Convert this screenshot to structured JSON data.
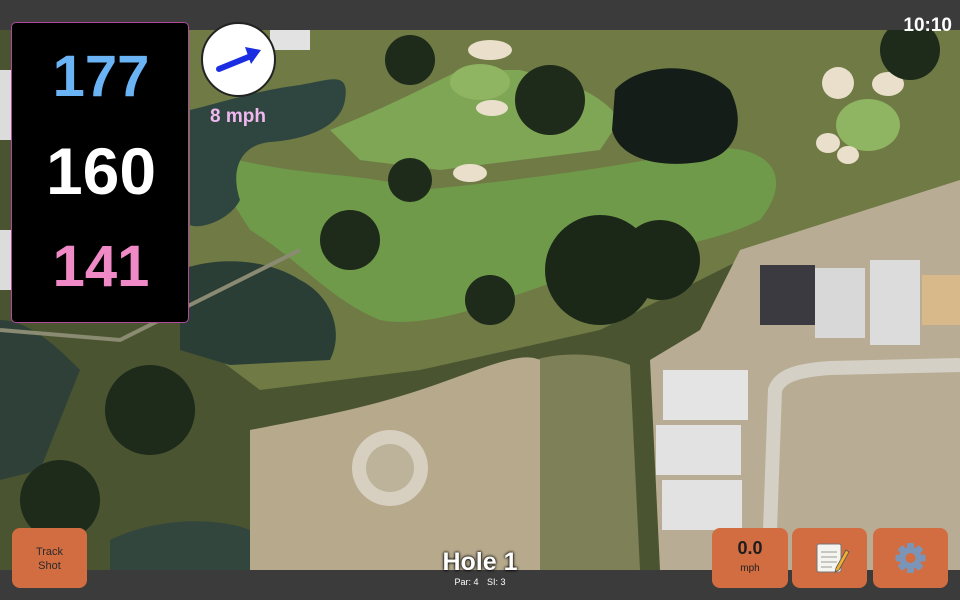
{
  "status": {
    "time": "10:10"
  },
  "distances": {
    "back": "177",
    "middle": "160",
    "front": "141",
    "back_color": "#6ab4f5",
    "middle_color": "#ffffff",
    "front_color": "#f08ac7"
  },
  "wind": {
    "speed": "8 mph",
    "icon": "wind-direction-arrow-icon"
  },
  "buttons": {
    "track_shot": {
      "line1": "Track",
      "line2": "Shot"
    },
    "speed": {
      "value": "0.0",
      "unit": "mph"
    },
    "notes": {
      "icon": "notepad-icon"
    },
    "settings": {
      "icon": "gear-icon"
    }
  },
  "hole": {
    "title": "Hole 1",
    "par": "Par: 4",
    "si": "SI: 3"
  },
  "colors": {
    "button": "#d26d42",
    "panel_border": "#b04a9a",
    "wind_arrow": "#1a2de0"
  }
}
